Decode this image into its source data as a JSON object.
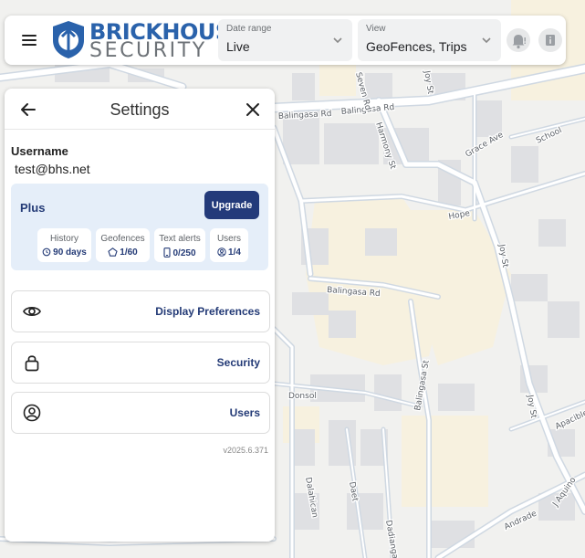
{
  "app": {
    "brand_line1": "BRICKHOUSE",
    "brand_line2": "SECURITY",
    "accent_color": "#233a7a"
  },
  "header": {
    "menu_icon": "hamburger-menu-icon",
    "date_range": {
      "label": "Date range",
      "value": "Live"
    },
    "view": {
      "label": "View",
      "value": "GeoFences, Trips"
    },
    "alerts_icon": "bell-alert-icon",
    "info_icon": "info-icon"
  },
  "settings": {
    "title": "Settings",
    "back_icon": "arrow-left-icon",
    "close_icon": "close-icon",
    "username_label": "Username",
    "username_value": "test@bhs.net",
    "plan": {
      "name": "Plus",
      "upgrade_label": "Upgrade",
      "stats": [
        {
          "label": "History",
          "value": "90 days",
          "icon": "history-icon"
        },
        {
          "label": "Geofences",
          "value": "1/60",
          "icon": "pentagon-icon"
        },
        {
          "label": "Text alerts",
          "value": "0/250",
          "icon": "phone-icon"
        },
        {
          "label": "Users",
          "value": "1/4",
          "icon": "user-circle-icon"
        }
      ]
    },
    "menu": [
      {
        "label": "Display Preferences",
        "icon": "eye-icon"
      },
      {
        "label": "Security",
        "icon": "lock-icon"
      },
      {
        "label": "Users",
        "icon": "user-circle-icon"
      }
    ],
    "version": "v2025.6.371"
  },
  "map": {
    "streets": [
      "Balingasa Rd",
      "Balingasa Rd",
      "Balingasa Rd",
      "Balingasa St",
      "Harmony St",
      "Grace Ave",
      "School",
      "Hope",
      "Joy St",
      "Joy St",
      "Joy St",
      "Donsol",
      "Dalahican",
      "Daet",
      "Dadiangas",
      "Andrade",
      "J Aquino",
      "Apacible",
      "Seven Rd"
    ]
  }
}
